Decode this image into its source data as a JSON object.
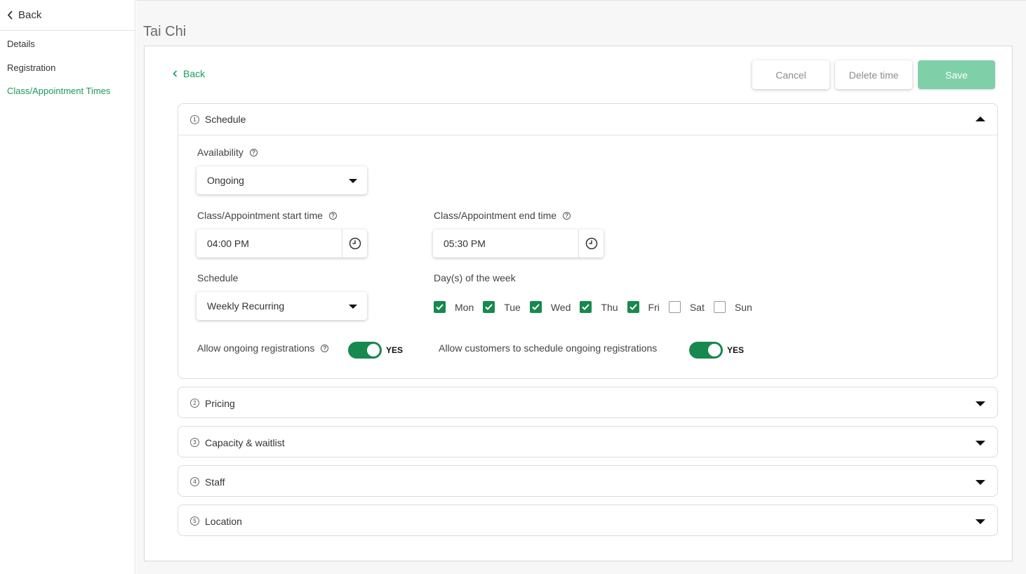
{
  "sidebar": {
    "back_label": "Back",
    "items": [
      {
        "label": "Details"
      },
      {
        "label": "Registration"
      },
      {
        "label": "Class/Appointment Times"
      }
    ]
  },
  "page": {
    "title": "Tai Chi",
    "back_label": "Back"
  },
  "actions": {
    "cancel": "Cancel",
    "delete": "Delete time",
    "save": "Save"
  },
  "sections": [
    {
      "num": "1",
      "title": "Schedule",
      "expanded": true
    },
    {
      "num": "2",
      "title": "Pricing",
      "expanded": false
    },
    {
      "num": "3",
      "title": "Capacity & waitlist",
      "expanded": false
    },
    {
      "num": "4",
      "title": "Staff",
      "expanded": false
    },
    {
      "num": "5",
      "title": "Location",
      "expanded": false
    }
  ],
  "schedule": {
    "availability_label": "Availability",
    "availability_value": "Ongoing",
    "start_label": "Class/Appointment start time",
    "start_value": "04:00 PM",
    "end_label": "Class/Appointment end time",
    "end_value": "05:30 PM",
    "schedule_label": "Schedule",
    "schedule_value": "Weekly Recurring",
    "days_label": "Day(s) of the week",
    "days": [
      {
        "label": "Mon",
        "checked": true
      },
      {
        "label": "Tue",
        "checked": true
      },
      {
        "label": "Wed",
        "checked": true
      },
      {
        "label": "Thu",
        "checked": true
      },
      {
        "label": "Fri",
        "checked": true
      },
      {
        "label": "Sat",
        "checked": false
      },
      {
        "label": "Sun",
        "checked": false
      }
    ],
    "ongoing_reg_label": "Allow ongoing registrations",
    "ongoing_reg_value": "YES",
    "customer_sched_label": "Allow customers to schedule ongoing registrations",
    "customer_sched_value": "YES"
  },
  "colors": {
    "accent": "#16894f",
    "link": "#1b9a5e",
    "save_disabled": "#7fd0a8"
  }
}
